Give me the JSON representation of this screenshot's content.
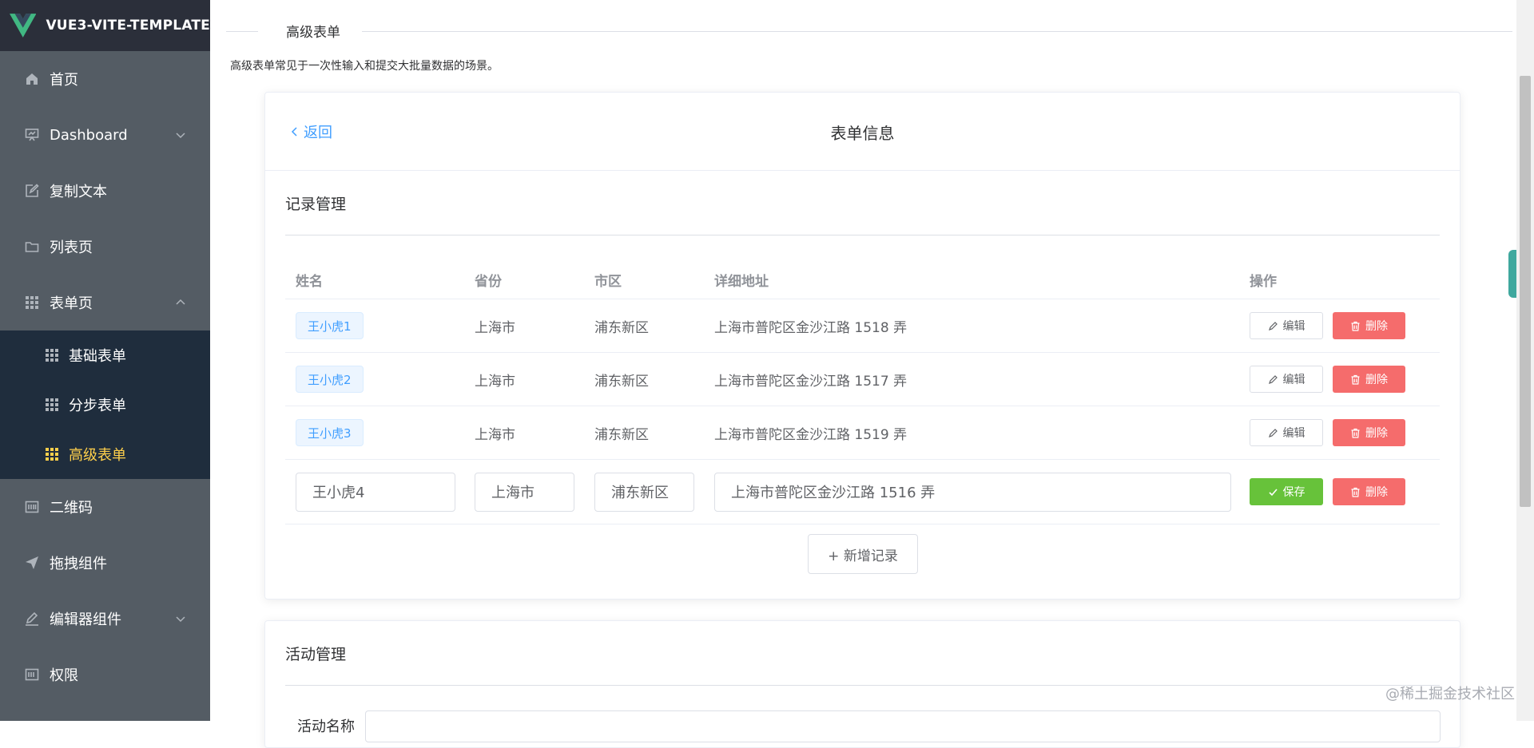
{
  "app": {
    "logo_text": "VUE3-VITE-TEMPLATE"
  },
  "sidebar": {
    "items": [
      {
        "label": "首页",
        "icon": "home-icon"
      },
      {
        "label": "Dashboard",
        "icon": "dashboard-icon",
        "expandable": true,
        "expanded": false
      },
      {
        "label": "复制文本",
        "icon": "edit-document-icon"
      },
      {
        "label": "列表页",
        "icon": "folder-icon"
      },
      {
        "label": "表单页",
        "icon": "grid-icon",
        "expandable": true,
        "expanded": true,
        "children": [
          {
            "label": "基础表单",
            "icon": "grid-icon"
          },
          {
            "label": "分步表单",
            "icon": "grid-icon"
          },
          {
            "label": "高级表单",
            "icon": "grid-icon",
            "active": true
          }
        ]
      },
      {
        "label": "二维码",
        "icon": "qrcode-icon"
      },
      {
        "label": "拖拽组件",
        "icon": "paper-plane-icon"
      },
      {
        "label": "编辑器组件",
        "icon": "pen-icon",
        "expandable": true,
        "expanded": false
      },
      {
        "label": "权限",
        "icon": "key-icon"
      }
    ]
  },
  "page": {
    "title": "高级表单",
    "description": "高级表单常见于一次性输入和提交大批量数据的场景。"
  },
  "card": {
    "back_label": "返回",
    "title": "表单信息",
    "record_section_title": "记录管理",
    "activity_section_title": "活动管理",
    "activity_partial_label": "活动名称"
  },
  "table": {
    "columns": [
      "姓名",
      "省份",
      "市区",
      "详细地址",
      "操作"
    ],
    "rows": [
      {
        "name": "王小虎1",
        "province": "上海市",
        "city": "浦东新区",
        "address": "上海市普陀区金沙江路 1518 弄"
      },
      {
        "name": "王小虎2",
        "province": "上海市",
        "city": "浦东新区",
        "address": "上海市普陀区金沙江路 1517 弄"
      },
      {
        "name": "王小虎3",
        "province": "上海市",
        "city": "浦东新区",
        "address": "上海市普陀区金沙江路 1519 弄"
      }
    ],
    "edit_row": {
      "name": "王小虎4",
      "province": "上海市",
      "city": "浦东新区",
      "address": "上海市普陀区金沙江路 1516 弄"
    },
    "edit_label": "编辑",
    "delete_label": "删除",
    "save_label": "保存",
    "add_label": "+ 新增记录"
  },
  "watermark": "@稀土掘金技术社区",
  "colors": {
    "sidebar_bg": "#545c64",
    "submenu_bg": "#1f2d3d",
    "active_text": "#ffd04b",
    "primary": "#409eff",
    "danger": "#f56c6c",
    "success": "#67c23a"
  }
}
